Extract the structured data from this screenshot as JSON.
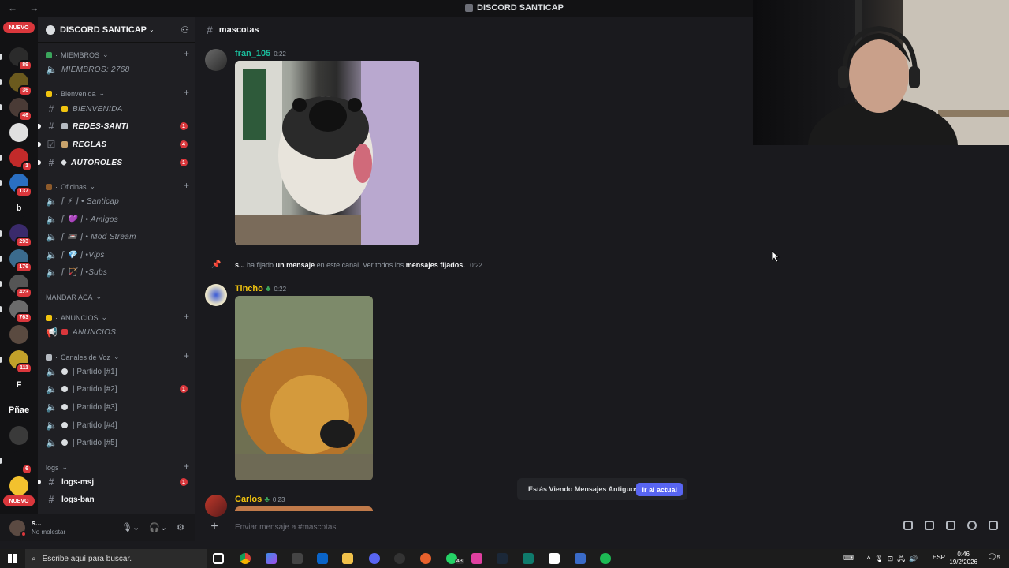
{
  "window": {
    "title": "DISCORD SANTICAP",
    "nav": "← →"
  },
  "rail": {
    "nuevo_top": "NUEVO",
    "nuevo_bottom": "NUEVO",
    "servers": [
      {
        "name": "server-1",
        "label": "",
        "badge": "89",
        "color": "#2b2b2b"
      },
      {
        "name": "server-2",
        "label": "",
        "badge": "36",
        "color": "#6b5a1e"
      },
      {
        "name": "server-3",
        "label": "",
        "badge": "46",
        "color": "#4a3b36"
      },
      {
        "name": "server-4",
        "label": "",
        "badge": "",
        "color": "#e0e0e0"
      },
      {
        "name": "server-5",
        "label": "",
        "badge": "1",
        "color": "#c22a2a"
      },
      {
        "name": "server-6",
        "label": "",
        "badge": "137",
        "color": "#2a6fc2"
      },
      {
        "name": "server-b",
        "label": "b",
        "badge": "",
        "color": "#121214"
      },
      {
        "name": "server-8",
        "label": "",
        "badge": "293",
        "color": "#3a2a6b"
      },
      {
        "name": "server-9",
        "label": "",
        "badge": "176",
        "color": "#3b6b8d"
      },
      {
        "name": "server-10",
        "label": "",
        "badge": "423",
        "color": "#555"
      },
      {
        "name": "server-11",
        "label": "",
        "badge": "763",
        "color": "#6b6b6b"
      },
      {
        "name": "server-12",
        "label": "",
        "badge": "",
        "color": "#5a4a40"
      },
      {
        "name": "server-13",
        "label": "",
        "badge": "111",
        "color": "#c2a12a"
      },
      {
        "name": "server-f",
        "label": "F",
        "badge": "",
        "color": "#121214"
      },
      {
        "name": "server-pnae",
        "label": "Pñae",
        "badge": "",
        "color": "#121214"
      },
      {
        "name": "server-16",
        "label": "",
        "badge": "",
        "color": "#3a3a3a"
      },
      {
        "name": "server-17",
        "label": "",
        "badge": "6",
        "color": "#121214"
      },
      {
        "name": "server-18",
        "label": "",
        "badge": "",
        "color": "#f2c12e"
      }
    ]
  },
  "sidebar": {
    "guild_name": "DISCORD SANTICAP",
    "categories": {
      "miembros": "MIEMBROS",
      "bienvenida": "Bienvenida",
      "oficinas": "Oficinas",
      "mandar": "MANDAR ACA",
      "anuncios": "ANUNCIOS",
      "voz": "Canales de Voz",
      "logs": "logs"
    },
    "channels": {
      "miembros": "MIEMBROS: 2768",
      "bienvenida": "BIENVENIDA",
      "redes": "REDES-SANTI",
      "redes_badge": "1",
      "reglas": "REGLAS",
      "reglas_badge": "4",
      "autoroles": "AUTOROLES",
      "autoroles_badge": "1",
      "santicap": "⌈ ⚡ ⌋ • Santicap",
      "amigos": "⌈ 💜 ⌋ • Amigos",
      "modstream": "⌈ 📼 ⌋ • Mod Stream",
      "vips": "⌈ 💎 ⌋ •Vips",
      "subs": "⌈ 🏹 ⌋ •Subs",
      "anuncios": "ANUNCIOS",
      "p1": "| Partido [#1]",
      "p2": "| Partido [#2]",
      "p2_badge": "1",
      "p3": "| Partido [#3]",
      "p4": "| Partido [#4]",
      "p5": "| Partido [#5]",
      "logs_msj": "logs-msj",
      "logs_msj_badge": "1",
      "logs_ban": "logs-ban"
    }
  },
  "user": {
    "name": "s...",
    "status": "No molestar"
  },
  "channel": {
    "name": "mascotas"
  },
  "messages": {
    "m1": {
      "author": "fran_105",
      "time": "0:22",
      "color": "#1abc9c"
    },
    "sys": {
      "prefix": "s...",
      "t1": "ha fijado",
      "t2": "un mensaje",
      "t3": "en este canal. Ver todos los",
      "t4": "mensajes fijados.",
      "time": "0:22"
    },
    "m2": {
      "author": "Tincho",
      "time": "0:22",
      "color": "#f1c40f"
    },
    "m3": {
      "author": "Carlos",
      "time": "0:23",
      "color": "#f1c40f"
    }
  },
  "oldbar": {
    "text": "Estás Viendo Mensajes Antiguos",
    "button": "Ir al actual"
  },
  "composer": {
    "placeholder": "Enviar mensaje a #mascotas"
  },
  "taskbar": {
    "search": "Escribe aquí para buscar.",
    "lang": "ESP",
    "time": "0:46",
    "date": "19/2/2026",
    "notif": "5",
    "discord_badge": "43"
  }
}
